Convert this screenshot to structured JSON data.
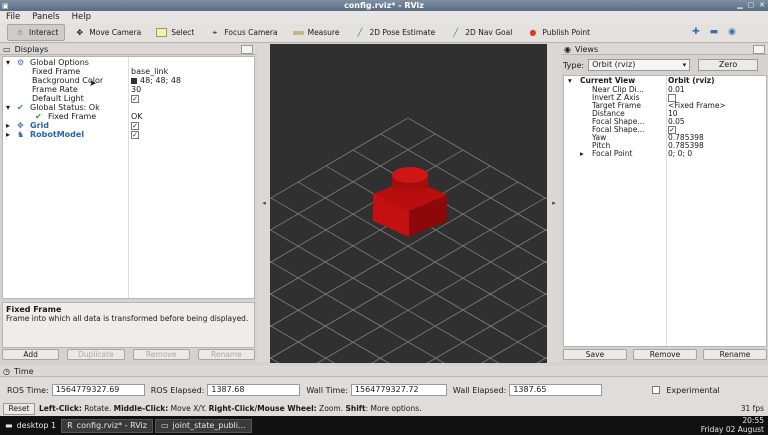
{
  "window": {
    "title": "config.rviz* - RViz"
  },
  "menu": {
    "file": "File",
    "panels": "Panels",
    "help": "Help"
  },
  "toolbar": {
    "interact": "Interact",
    "move_camera": "Move Camera",
    "select": "Select",
    "focus_camera": "Focus Camera",
    "measure": "Measure",
    "pose_estimate": "2D Pose Estimate",
    "nav_goal": "2D Nav Goal",
    "publish_point": "Publish Point"
  },
  "displays": {
    "title": "Displays",
    "global_options": "Global Options",
    "fixed_frame_key": "Fixed Frame",
    "fixed_frame_val": "base_link",
    "bg_color_key": "Background Color",
    "bg_color_val": "48; 48; 48",
    "frame_rate_key": "Frame Rate",
    "frame_rate_val": "30",
    "default_light_key": "Default Light",
    "global_status": "Global Status: Ok",
    "status_fixed_frame_key": "Fixed Frame",
    "status_fixed_frame_val": "OK",
    "grid": "Grid",
    "robot_model": "RobotModel",
    "desc_title": "Fixed Frame",
    "desc_text": "Frame into which all data is transformed before being displayed.",
    "buttons": {
      "add": "Add",
      "duplicate": "Duplicate",
      "remove": "Remove",
      "rename": "Rename"
    }
  },
  "views": {
    "title": "Views",
    "type_label": "Type:",
    "type_value": "Orbit (rviz)",
    "zero": "Zero",
    "current_view": "Current View",
    "current_view_val": "Orbit (rviz)",
    "rows": [
      {
        "k": "Near Clip Di...",
        "v": "0.01"
      },
      {
        "k": "Invert Z Axis",
        "v": ""
      },
      {
        "k": "Target Frame",
        "v": "<Fixed Frame>"
      },
      {
        "k": "Distance",
        "v": "10"
      },
      {
        "k": "Focal Shape...",
        "v": "0.05"
      },
      {
        "k": "Focal Shape...",
        "v": "✓"
      },
      {
        "k": "Yaw",
        "v": "0.785398"
      },
      {
        "k": "Pitch",
        "v": "0.785398"
      },
      {
        "k": "Focal Point",
        "v": "0; 0; 0"
      }
    ],
    "buttons": {
      "save": "Save",
      "remove": "Remove",
      "rename": "Rename"
    }
  },
  "time": {
    "title": "Time",
    "ros_time_label": "ROS Time:",
    "ros_time": "1564779327.69",
    "ros_elapsed_label": "ROS Elapsed:",
    "ros_elapsed": "1387.68",
    "wall_time_label": "Wall Time:",
    "wall_time": "1564779327.72",
    "wall_elapsed_label": "Wall Elapsed:",
    "wall_elapsed": "1387.65",
    "experimental": "Experimental"
  },
  "status": {
    "reset": "Reset",
    "left_click": "Left-Click:",
    "left_click_text": " Rotate. ",
    "middle_click": "Middle-Click:",
    "middle_click_text": " Move X/Y. ",
    "right_click": "Right-Click/Mouse Wheel:",
    "right_click_text": " Zoom. ",
    "shift": "Shift",
    "shift_text": ": More options.",
    "fps": "31 fps"
  },
  "taskbar": {
    "desktop": "desktop 1",
    "win1": "config.rviz* - RViz",
    "win2": "joint_state_publi...",
    "time": "20:55",
    "date": "Friday 02 August"
  },
  "colors": {
    "robot": "#c41010",
    "viewport_bg": "#303030",
    "grid": "#8a8a8a"
  }
}
